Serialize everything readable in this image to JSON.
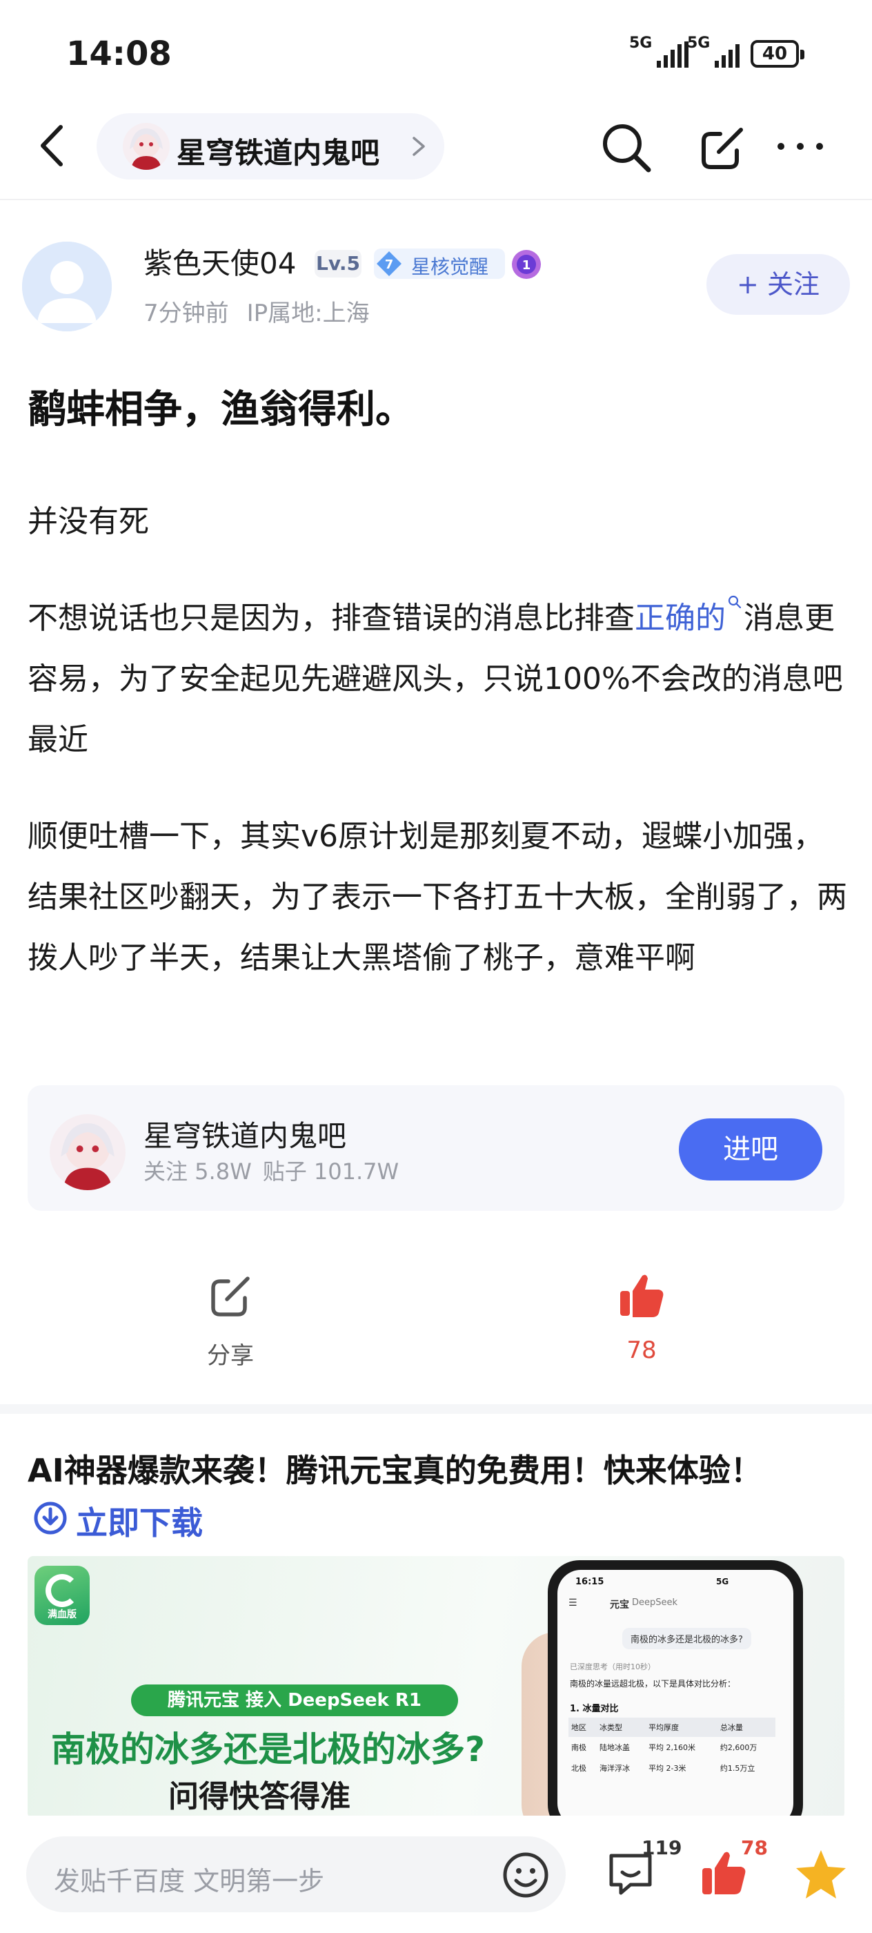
{
  "status_bar": {
    "time": "14:08",
    "signal1": "5G",
    "signal2": "5G",
    "battery": "40"
  },
  "nav": {
    "forum_name": "星穹铁道内鬼吧"
  },
  "author": {
    "name": "紫色天使04",
    "level": "Lv.5",
    "badge_level": "7",
    "badge_text": "星核觉醒",
    "medal_num": "1",
    "time_ago": "7分钟前",
    "ip": "IP属地:上海",
    "follow_label": "+ 关注"
  },
  "post": {
    "title": "鹬蚌相争，渔翁得利。",
    "p1": "并没有死",
    "p2_a": "不想说话也只是因为，排查错误的消息比排查",
    "p2_link": "正确的",
    "p2_b": "消息更容易，为了安全起见先避避风头，只说100%不会改的消息吧最近",
    "p3": "顺便吐槽一下，其实v6原计划是那刻夏不动，遐蝶小加强，结果社区吵翻天，为了表示一下各打五十大板，全削弱了，两拨人吵了半天，结果让大黑塔偷了桃子，意难平啊"
  },
  "forum_card": {
    "name": "星穹铁道内鬼吧",
    "followers": "关注 5.8W",
    "posts": "贴子 101.7W",
    "enter_label": "进吧"
  },
  "actions": {
    "share_label": "分享",
    "like_count": "78"
  },
  "ad": {
    "title": "AI神器爆款来袭！腾讯元宝真的免费用！快来体验！",
    "cta": "立即下载",
    "logo_text": "满血版",
    "pill": "腾讯元宝 接入 DeepSeek R1",
    "headline": "南极的冰多还是北极的冰多?",
    "sub": "问得快答得准",
    "phone": {
      "time": "16:15",
      "status_right": "5G",
      "app": "元宝",
      "model": "DeepSeek",
      "question": "南极的冰多还是北极的冰多?",
      "thinking": "已深度思考（用时10秒）",
      "answer": "南极的冰量远超北极，以下是具体对比分析：",
      "section": "1. 冰量对比",
      "table_headers": [
        "地区",
        "冰类型",
        "平均厚度",
        "总冰量"
      ],
      "table_rows": [
        [
          "南极",
          "陆地冰盖",
          "平均 2,160米",
          "约2,600万"
        ],
        [
          "北极",
          "海洋浮冰",
          "平均 2-3米",
          "约1.5万立"
        ]
      ]
    }
  },
  "bottom_bar": {
    "placeholder": "发贴千百度 文明第一步",
    "comment_count": "119",
    "like_count": "78"
  },
  "colors": {
    "link": "#3f62d6",
    "primary_button": "#4a6cf2",
    "like_red": "#e04a3c",
    "star_gold": "#f5b323"
  }
}
